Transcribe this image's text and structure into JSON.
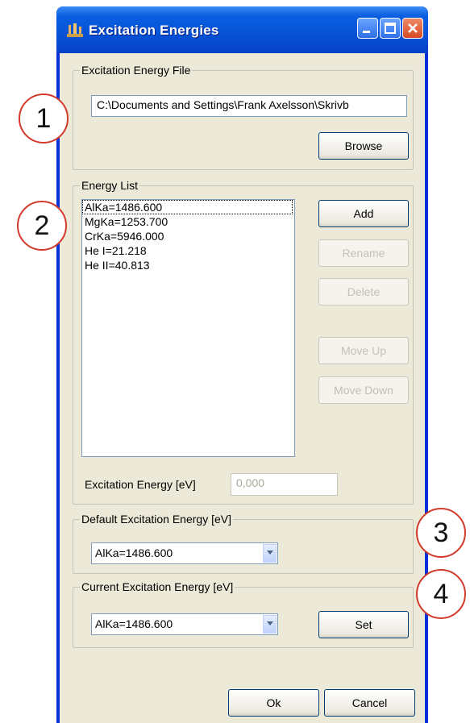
{
  "window": {
    "title": "Excitation Energies"
  },
  "file_group": {
    "label": "Excitation Energy File",
    "path": "C:\\Documents and Settings\\Frank Axelsson\\Skrivb",
    "browse_label": "Browse"
  },
  "energy_group": {
    "label": "Energy List",
    "items": [
      "AlKa=1486.600",
      "MgKa=1253.700",
      "CrKa=5946.000",
      "He I=21.218",
      "He II=40.813"
    ],
    "buttons": {
      "add": "Add",
      "rename": "Rename",
      "delete": "Delete",
      "move_up": "Move Up",
      "move_down": "Move Down"
    },
    "energy_label": "Excitation Energy [eV]",
    "energy_value": "0,000"
  },
  "default_group": {
    "label": "Default Excitation Energy [eV]",
    "selected": "AlKa=1486.600"
  },
  "current_group": {
    "label": "Current Excitation Energy [eV]",
    "selected": "AlKa=1486.600",
    "set_label": "Set"
  },
  "footer": {
    "ok_label": "Ok",
    "cancel_label": "Cancel"
  },
  "callouts": [
    "1",
    "2",
    "3",
    "4"
  ],
  "colors": {
    "title_bar": "#0a5fe0",
    "dialog_bg": "#ece9d8",
    "callout_border": "#d23a2a"
  }
}
